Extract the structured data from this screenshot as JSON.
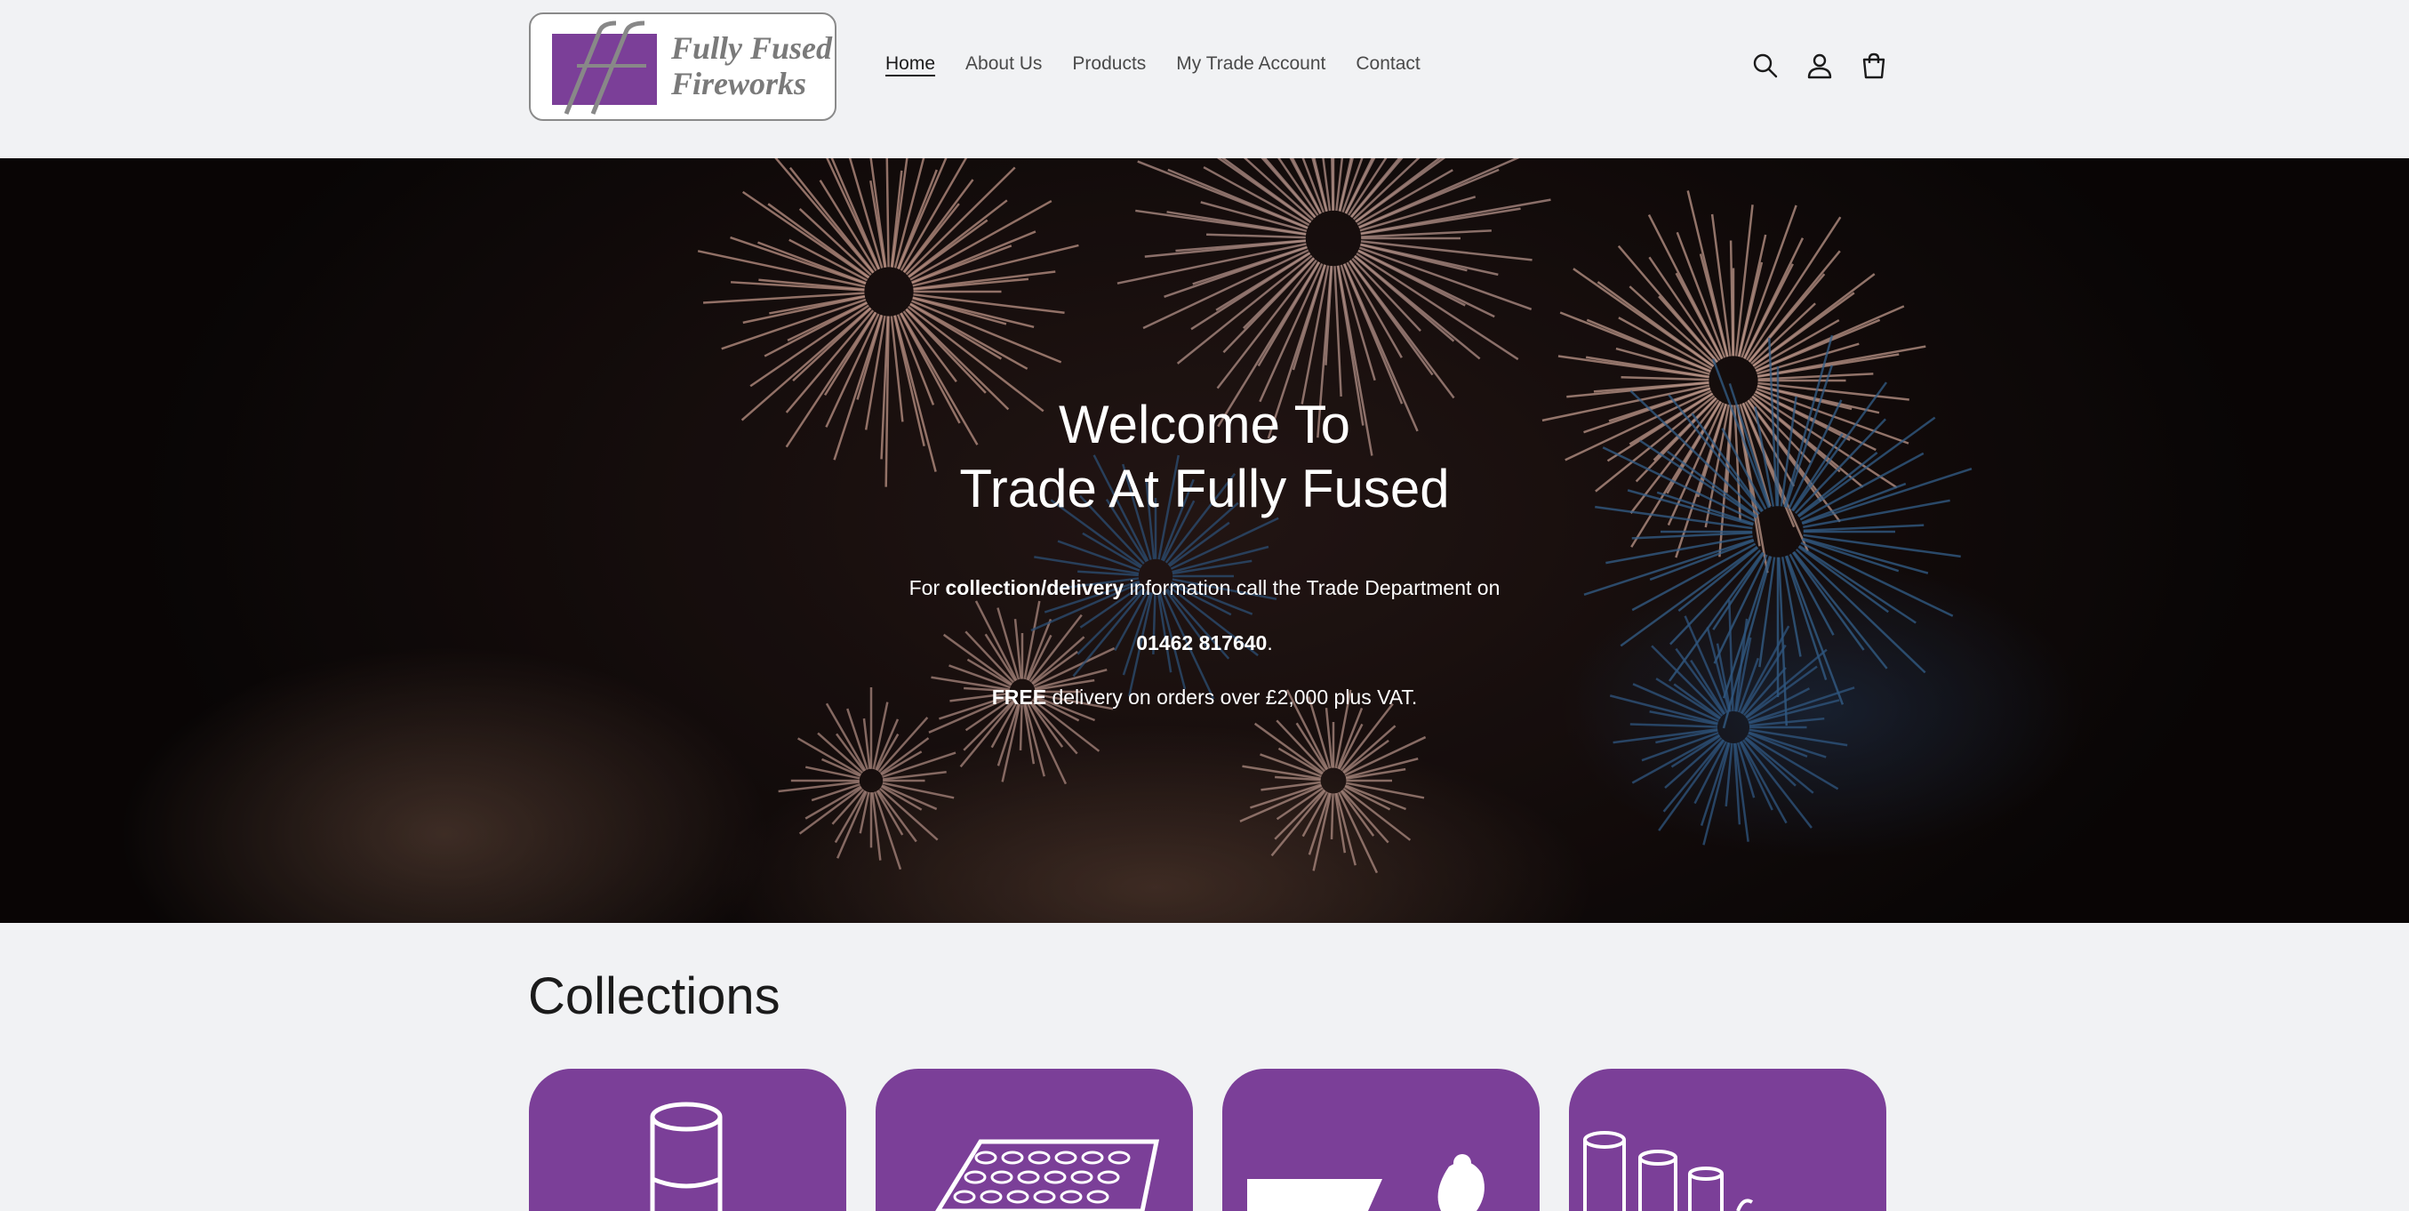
{
  "logo": {
    "line1": "Fully Fused",
    "line2": "Fireworks"
  },
  "nav": {
    "items": [
      {
        "label": "Home",
        "active": true
      },
      {
        "label": "About Us"
      },
      {
        "label": "Products"
      },
      {
        "label": "My Trade Account"
      },
      {
        "label": "Contact"
      }
    ]
  },
  "icons": [
    "search-icon",
    "account-icon",
    "cart-icon"
  ],
  "hero": {
    "title_line1": "Welcome To",
    "title_line2": "Trade At Fully Fused",
    "info_prefix": "For ",
    "info_bold": "collection/delivery",
    "info_suffix": " information call the Trade Department on",
    "phone": "01462 817640",
    "phone_suffix": ".",
    "delivery_bold": "FREE",
    "delivery_text": " delivery on orders over £2,000 plus VAT."
  },
  "collections": {
    "title": "Collections",
    "cards": [
      {
        "icon": "single-tube-icon"
      },
      {
        "icon": "cake-grid-icon"
      },
      {
        "icon": "rocket-icon"
      },
      {
        "icon": "tubes-icon"
      }
    ]
  },
  "colors": {
    "brand_purple": "#7b3f98",
    "background": "#f1f2f4"
  }
}
